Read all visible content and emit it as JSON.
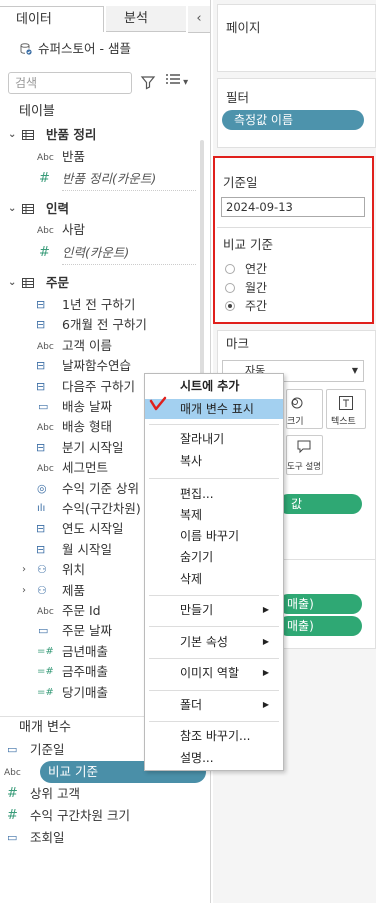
{
  "tabs": {
    "data": "데이터",
    "analytics": "분석",
    "collapse": "‹"
  },
  "datasource": "슈퍼스토어 - 샘플",
  "search": {
    "placeholder": "검색"
  },
  "tables_header": "테이블",
  "tables": [
    {
      "name": "반품 정리",
      "fields": [
        {
          "type": "Abc",
          "name": "반품"
        },
        {
          "type": "#",
          "name": "반품 정리(카운트)",
          "italic": true
        }
      ]
    },
    {
      "name": "인력",
      "fields": [
        {
          "type": "Abc",
          "name": "사람"
        },
        {
          "type": "#",
          "name": "인력(카운트)",
          "italic": true
        }
      ]
    },
    {
      "name": "주문",
      "fields": [
        {
          "type": "cal",
          "name": "1년 전 구하기"
        },
        {
          "type": "cal",
          "name": "6개월 전 구하기"
        },
        {
          "type": "Abc",
          "name": "고객 이름"
        },
        {
          "type": "cal",
          "name": "날짜함수연습"
        },
        {
          "type": "cal",
          "name": "다음주 구하기"
        },
        {
          "type": "date",
          "name": "배송 날짜"
        },
        {
          "type": "Abc",
          "name": "배송 형태"
        },
        {
          "type": "cal",
          "name": "분기 시작일"
        },
        {
          "type": "Abc",
          "name": "세그먼트"
        },
        {
          "type": "set",
          "name": "수익 기준 상위"
        },
        {
          "type": "bin",
          "name": "수익(구간차원)"
        },
        {
          "type": "cal",
          "name": "연도 시작일"
        },
        {
          "type": "cal",
          "name": "월 시작일"
        },
        {
          "type": "hier",
          "name": "위치"
        },
        {
          "type": "hier",
          "name": "제품"
        },
        {
          "type": "Abc",
          "name": "주문 Id"
        },
        {
          "type": "date",
          "name": "주문 날짜"
        },
        {
          "type": "#calc",
          "name": "금년매출"
        },
        {
          "type": "#calc",
          "name": "금주매출"
        },
        {
          "type": "#calc",
          "name": "당기매출"
        }
      ]
    }
  ],
  "params_header": "매개 변수",
  "parameters": [
    {
      "type": "date",
      "name": "기준일"
    },
    {
      "type": "Abc",
      "name": "비교 기준"
    },
    {
      "type": "#",
      "name": "상위 고객"
    },
    {
      "type": "#",
      "name": "수익 구간차원 크기"
    },
    {
      "type": "date",
      "name": "조회일"
    }
  ],
  "shelves": {
    "pages": "페이지",
    "filters": "필터",
    "filter_pill": "측정값 이름",
    "marks": "마크",
    "marks_type": "자동",
    "marks_buttons": {
      "size": "크기",
      "text": "텍스트",
      "tooltip": "도구 설명"
    },
    "pill_value": "값",
    "pill_sales1": "매출)",
    "pill_sales2": "매출)"
  },
  "param_card": {
    "title": "기준일",
    "date_value": "2024-09-13",
    "compare_title": "비교 기준",
    "options": [
      "연간",
      "월간",
      "주간"
    ],
    "selected": "주간"
  },
  "context_menu": {
    "items": [
      "시트에 추가",
      "매개 변수 표시",
      "잘라내기",
      "복사",
      "편집...",
      "복제",
      "이름 바꾸기",
      "숨기기",
      "삭제",
      "만들기",
      "기본 속성",
      "이미지 역할",
      "폴더",
      "참조 바꾸기...",
      "설명..."
    ]
  },
  "colors": {
    "annotation": "#e0201c",
    "pill_blue": "#4d93ac",
    "pill_green": "#2fa874",
    "menu_highlight": "#a3d0f0"
  }
}
